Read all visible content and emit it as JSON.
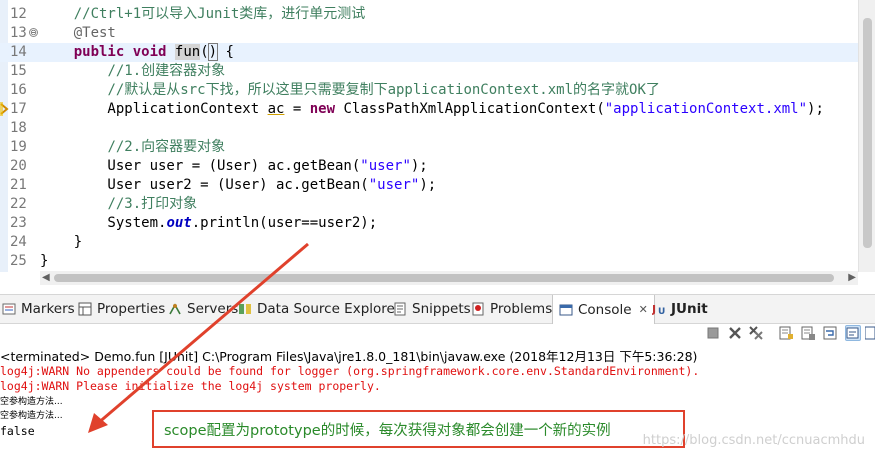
{
  "editor": {
    "lines": [
      {
        "num": "12",
        "parts": [
          {
            "t": "    "
          },
          {
            "t": "//Ctrl+1可以导入Junit类库，进行单元测试",
            "c": "cm"
          }
        ]
      },
      {
        "num": "13",
        "fold": "⊖",
        "parts": [
          {
            "t": "    "
          },
          {
            "t": "@Test",
            "c": "ann"
          }
        ]
      },
      {
        "num": "14",
        "current": true,
        "parts": [
          {
            "t": "    "
          },
          {
            "t": "public",
            "c": "kw"
          },
          {
            "t": " "
          },
          {
            "t": "void",
            "c": "kw"
          },
          {
            "t": " "
          },
          {
            "t": "fun",
            "c": "hl"
          },
          {
            "t": "("
          },
          {
            "t": ")",
            "c": "bracket"
          },
          {
            "t": " {"
          }
        ]
      },
      {
        "num": "15",
        "parts": [
          {
            "t": "        "
          },
          {
            "t": "//1.创建容器对象",
            "c": "cm"
          }
        ]
      },
      {
        "num": "16",
        "parts": [
          {
            "t": "        "
          },
          {
            "t": "//默认是从src下找，所以这里只需要复制下applicationContext.xml的名字就OK了",
            "c": "cm"
          }
        ]
      },
      {
        "num": "17",
        "warn": true,
        "parts": [
          {
            "t": "        ApplicationContext "
          },
          {
            "t": "ac",
            "c": "ul"
          },
          {
            "t": " = "
          },
          {
            "t": "new",
            "c": "kw"
          },
          {
            "t": " ClassPathXmlApplicationContext("
          },
          {
            "t": "\"applicationContext.xml\"",
            "c": "str"
          },
          {
            "t": ");"
          }
        ]
      },
      {
        "num": "18",
        "parts": [
          {
            "t": ""
          }
        ]
      },
      {
        "num": "19",
        "parts": [
          {
            "t": "        "
          },
          {
            "t": "//2.向容器要对象",
            "c": "cm"
          }
        ]
      },
      {
        "num": "20",
        "parts": [
          {
            "t": "        User user = (User) ac.getBean("
          },
          {
            "t": "\"user\"",
            "c": "str"
          },
          {
            "t": ");"
          }
        ]
      },
      {
        "num": "21",
        "parts": [
          {
            "t": "        User user2 = (User) ac.getBean("
          },
          {
            "t": "\"user\"",
            "c": "str"
          },
          {
            "t": ");"
          }
        ]
      },
      {
        "num": "22",
        "parts": [
          {
            "t": "        "
          },
          {
            "t": "//3.打印对象",
            "c": "cm"
          }
        ]
      },
      {
        "num": "23",
        "parts": [
          {
            "t": "        System."
          },
          {
            "t": "out",
            "c": "fld"
          },
          {
            "t": ".println(user==user2);"
          }
        ]
      },
      {
        "num": "24",
        "parts": [
          {
            "t": "    }"
          }
        ]
      },
      {
        "num": "25",
        "parts": [
          {
            "t": "}"
          }
        ]
      }
    ]
  },
  "tabs": [
    {
      "label": "Markers",
      "icon": "markers-icon"
    },
    {
      "label": "Properties",
      "icon": "properties-icon"
    },
    {
      "label": "Servers",
      "icon": "servers-icon"
    },
    {
      "label": "Data Source Explorer",
      "icon": "data-source-explorer-icon"
    },
    {
      "label": "Snippets",
      "icon": "snippets-icon"
    },
    {
      "label": "Problems",
      "icon": "problems-icon"
    },
    {
      "label": "Console",
      "icon": "console-icon",
      "active": true,
      "close": "✕"
    },
    {
      "label": "JUnit",
      "icon": "junit-icon"
    }
  ],
  "console": {
    "terminated": "<terminated> Demo.fun [JUnit] C:\\Program Files\\Java\\jre1.8.0_181\\bin\\javaw.exe (2018年12月13日 下午5:36:28)",
    "lines": [
      {
        "text": "log4j:WARN No appenders could be found for logger (org.springframework.core.env.StandardEnvironment).",
        "type": "err"
      },
      {
        "text": "log4j:WARN Please initialize the log4j system properly.",
        "type": "err"
      },
      {
        "text": "空参构造方法...",
        "type": "small"
      },
      {
        "text": "空参构造方法...",
        "type": "small"
      },
      {
        "text": "false",
        "type": "out"
      }
    ]
  },
  "callout": {
    "text": "scope配置为prototype的时候，每次获得对象都会创建一个新的实例"
  },
  "watermark": "https://blog.csdn.net/ccnuacmhdu",
  "colors": {
    "keyword": "#7f0055",
    "comment": "#3f7f5f",
    "string": "#2a00ff",
    "error": "#e01010",
    "callout_border": "#e0412c",
    "callout_text": "#2a8a2a",
    "arrow": "#e0412c"
  }
}
